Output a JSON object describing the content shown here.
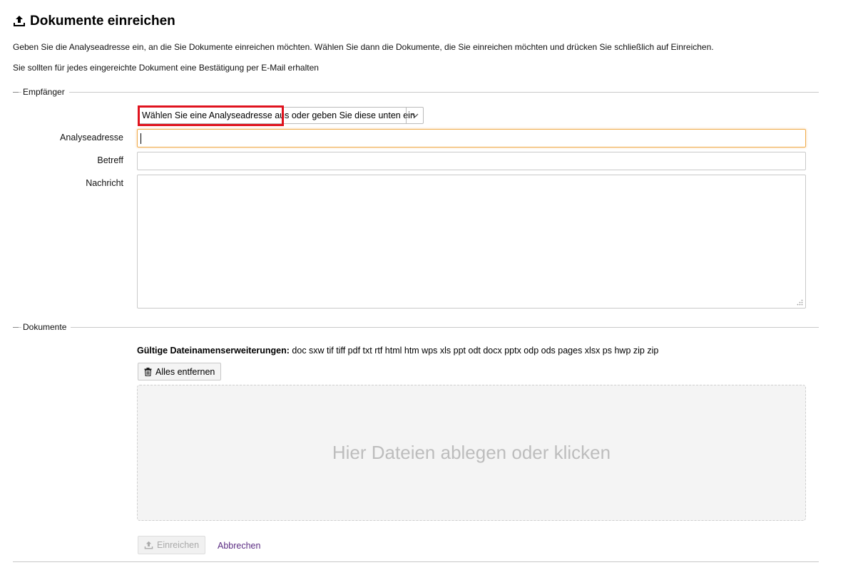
{
  "page": {
    "title": "Dokumente einreichen",
    "intro_line1": "Geben Sie die Analyseadresse ein, an die Sie Dokumente einreichen möchten. Wählen Sie dann die Dokumente, die Sie einreichen möchten und drücken Sie schließlich auf Einreichen.",
    "intro_line2": "Sie sollten für jedes eingereichte Dokument eine Bestätigung per E-Mail erhalten"
  },
  "recipient": {
    "legend": "Empfänger",
    "select_value": "Wählen Sie eine Analyseadresse aus oder geben Sie diese unten ein",
    "address_label": "Analyseadresse",
    "address_value": "",
    "subject_label": "Betreff",
    "subject_value": "",
    "message_label": "Nachricht",
    "message_value": ""
  },
  "documents": {
    "legend": "Dokumente",
    "extensions_label": "Gültige Dateinamenserweiterungen:",
    "extensions": "doc sxw tif tiff pdf txt rtf html htm wps xls ppt odt docx pptx odp ods pages xlsx ps hwp zip zip",
    "remove_all_label": "Alles entfernen",
    "dropzone_text": "Hier Dateien ablegen oder klicken"
  },
  "actions": {
    "submit_label": "Einreichen",
    "submit_enabled": false,
    "cancel_label": "Abbrechen"
  },
  "colors": {
    "highlight": "#e0131e",
    "link": "#5b2c83",
    "focus_border": "#f0ad4e"
  }
}
